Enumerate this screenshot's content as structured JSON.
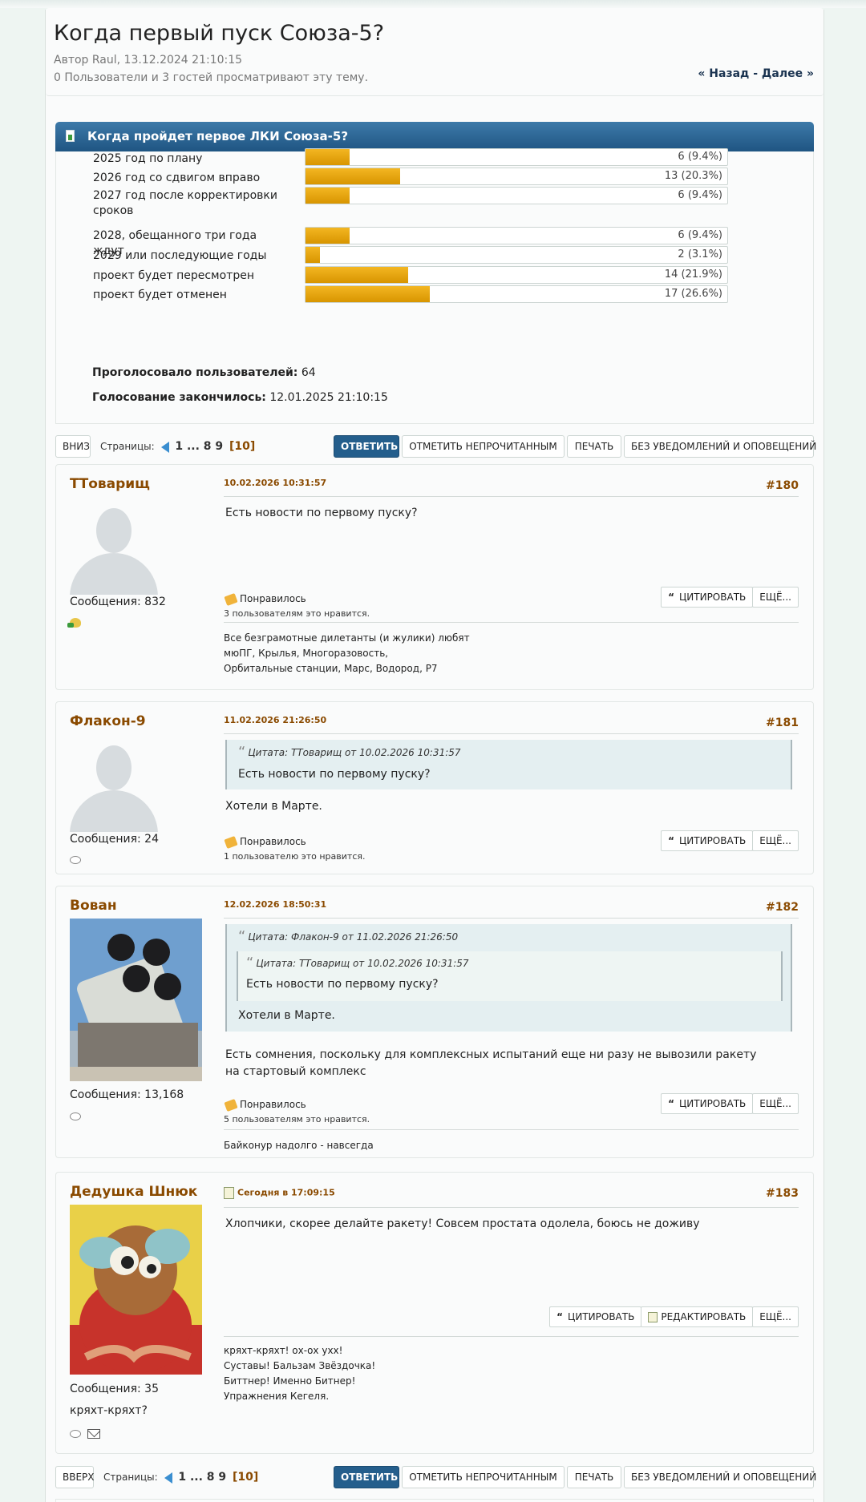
{
  "topic": {
    "title": "Когда первый пуск Союза-5?",
    "author_line": "Автор Raul, 13.12.2024 21:10:15",
    "viewers_line": "0 Пользователи и 3 гостей просматривают эту тему.",
    "nav": "« Назад - Далее »"
  },
  "poll": {
    "question": "Когда пройдет первое ЛКИ Союза-5?",
    "options": [
      {
        "label": "2025 год по плану",
        "votes_text": "6 (9.4%)",
        "percent": 9.4
      },
      {
        "label": "2026 год со сдвигом вправо",
        "votes_text": "13 (20.3%)",
        "percent": 20.3
      },
      {
        "label": "2027 год после корректировки сроков",
        "votes_text": "6 (9.4%)",
        "percent": 9.4
      },
      {
        "label": "2028, обещанного три года ждут",
        "votes_text": "6 (9.4%)",
        "percent": 9.4
      },
      {
        "label": "2029 или последующие годы",
        "votes_text": "2 (3.1%)",
        "percent": 3.1
      },
      {
        "label": "проект будет пересмотрен",
        "votes_text": "14 (21.9%)",
        "percent": 21.9
      },
      {
        "label": "проект будет отменен",
        "votes_text": "17 (26.6%)",
        "percent": 26.6
      }
    ],
    "voted_label": "Проголосовало пользователей:",
    "voted_value": "64",
    "ended_label": "Голосование закончилось:",
    "ended_value": "12.01.2025 21:10:15"
  },
  "toolbar_top": {
    "jump": "ВНИЗ",
    "pages_label": "Страницы:",
    "pages": "1 ... 8 9",
    "current_page": "[10]",
    "reply": "ОТВЕТИТЬ",
    "mark_unread": "ОТМЕТИТЬ НЕПРОЧИТАННЫМ",
    "print": "ПЕЧАТЬ",
    "no_notify": "БЕЗ УВЕДОМЛЕНИЙ И ОПОВЕЩЕНИЙ"
  },
  "toolbar_bottom": {
    "jump": "ВВЕРХ",
    "pages_label": "Страницы:",
    "pages": "1 ... 8 9",
    "current_page": "[10]",
    "reply": "ОТВЕТИТЬ",
    "mark_unread": "ОТМЕТИТЬ НЕПРОЧИТАННЫМ",
    "print": "ПЕЧАТЬ",
    "no_notify": "БЕЗ УВЕДОМЛЕНИЙ И ОПОВЕЩЕНИЙ"
  },
  "labels": {
    "like": "Понравилось",
    "quote": "ЦИТИРОВАТЬ",
    "edit": "РЕДАКТИРОВАТЬ",
    "more": "ЕЩЁ..."
  },
  "posts": [
    {
      "author": "ТТоварищ",
      "date": "10.02.2026 10:31:57",
      "number": "#180",
      "messages": "Сообщения: 832",
      "text": "Есть новости по первому пуску?",
      "likes": "3 пользователям это нравится.",
      "signature": [
        "Все безграмотные дилетанты (и жулики) любят",
        "мюПГ, Крылья, Многоразовость,",
        "Орбитальные станции, Марс, Водород, Р7"
      ]
    },
    {
      "author": "Флакон-9",
      "date": "11.02.2026 21:26:50",
      "number": "#181",
      "messages": "Сообщения: 24",
      "quote_header": "Цитата: ТТоварищ от 10.02.2026 10:31:57",
      "quote_text": "Есть новости по первому пуску?",
      "text": "Хотели в Марте.",
      "likes": "1 пользователю это нравится."
    },
    {
      "author": "Вован",
      "date": "12.02.2026 18:50:31",
      "number": "#182",
      "messages": "Сообщения: 13,168",
      "quote_header": "Цитата: Флакон-9 от 11.02.2026 21:26:50",
      "inner_quote_header": "Цитата: ТТоварищ от 10.02.2026 10:31:57",
      "inner_quote_text": "Есть новости по первому пуску?",
      "quote_text": "Хотели в Марте.",
      "text": "Есть сомнения, поскольку для комплексных испытаний еще ни разу не вывозили ракету на стартовый комплекс",
      "likes": "5 пользователям это нравится.",
      "signature": [
        "Байконур надолго - навсегда"
      ]
    },
    {
      "author": "Дедушка Шнюк",
      "date": "Сегодня в 17:09:15",
      "number": "#183",
      "messages": "Сообщения: 35",
      "user_text": "кряхт-кряхт?",
      "text": "Хлопчики, скорее делайте ракету! Совсем простата одолела, боюсь не доживу",
      "signature": [
        "кряхт-кряхт! ох-ох ухх!",
        "Суставы! Бальзам Звёздочка!",
        "Биттнер! Именно Битнер!",
        "Упражнения Кегеля."
      ]
    }
  ],
  "colors": {
    "accent": "#245e8c",
    "username": "#8a4a00",
    "poll_bar": "#f3b622"
  }
}
